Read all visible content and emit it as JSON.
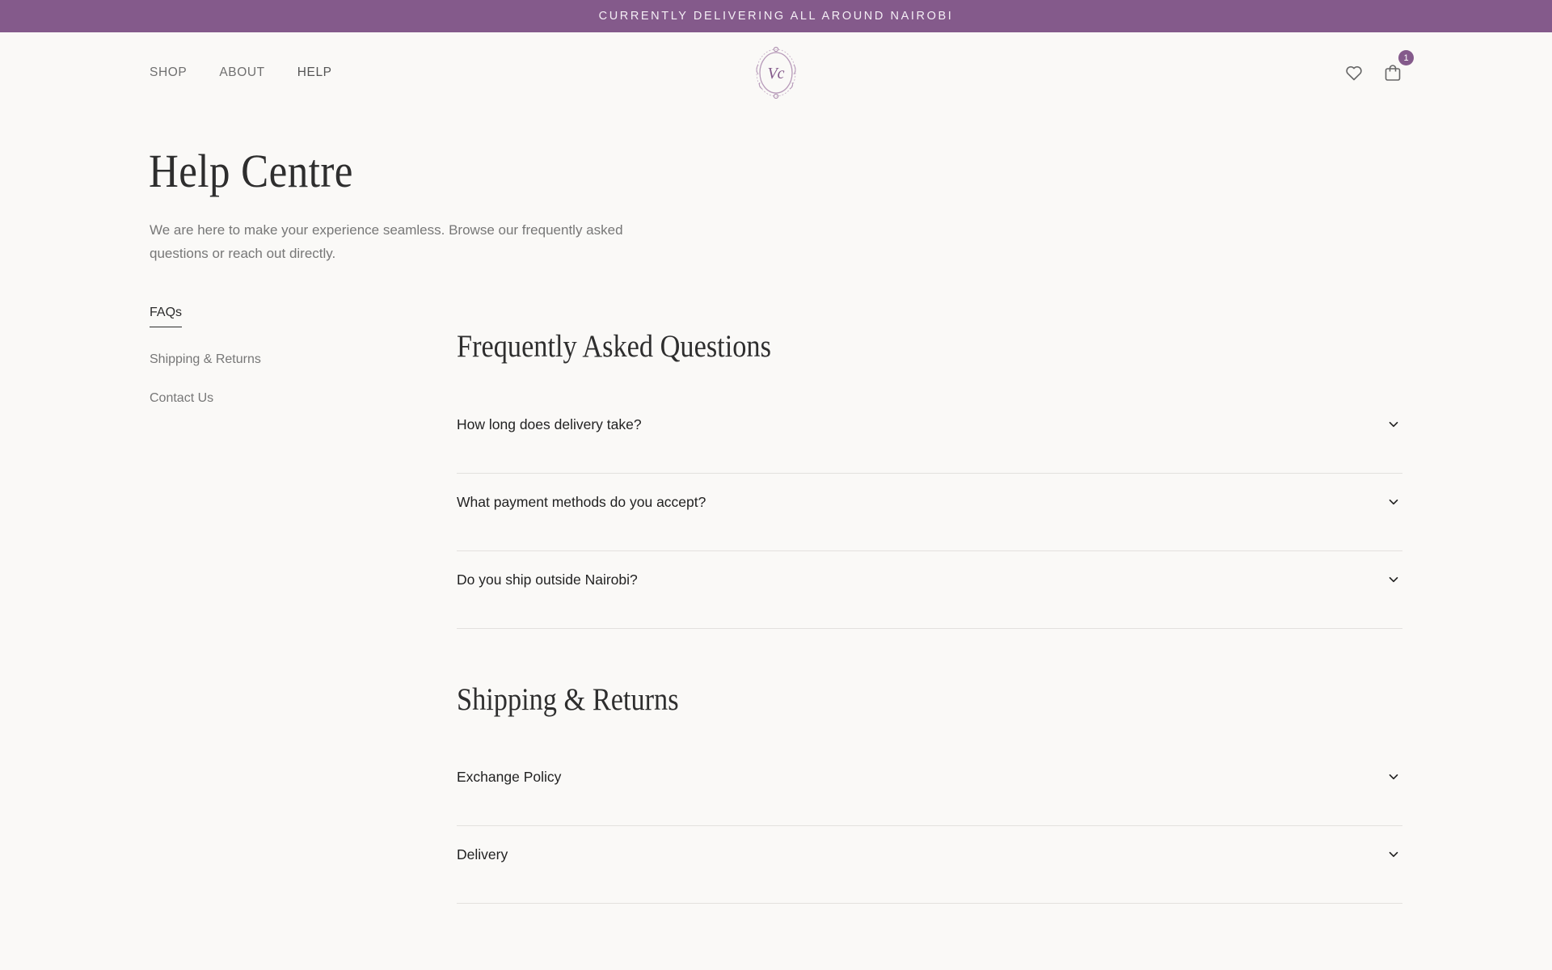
{
  "announcement": "CURRENTLY DELIVERING ALL AROUND NAIROBI",
  "nav": {
    "shop": "SHOP",
    "about": "ABOUT",
    "help": "HELP"
  },
  "logo_text": "Vc",
  "cart": {
    "count": "1"
  },
  "page": {
    "title": "Help Centre",
    "intro": "We are here to make your experience seamless. Browse our frequently asked questions or reach out directly."
  },
  "sidebar": {
    "items": [
      {
        "label": "FAQs"
      },
      {
        "label": "Shipping & Returns"
      },
      {
        "label": "Contact Us"
      }
    ]
  },
  "faq": {
    "title": "Frequently Asked Questions",
    "items": [
      {
        "question": "How long does delivery take?"
      },
      {
        "question": "What payment methods do you accept?"
      },
      {
        "question": "Do you ship outside Nairobi?"
      }
    ]
  },
  "shipping": {
    "title": "Shipping & Returns",
    "items": [
      {
        "question": "Exchange Policy"
      },
      {
        "question": "Delivery"
      }
    ]
  },
  "colors": {
    "accent": "#845a8b",
    "background": "#faf9f7"
  },
  "icons": [
    "heart-icon",
    "cart-icon",
    "chevron-down-icon"
  ]
}
